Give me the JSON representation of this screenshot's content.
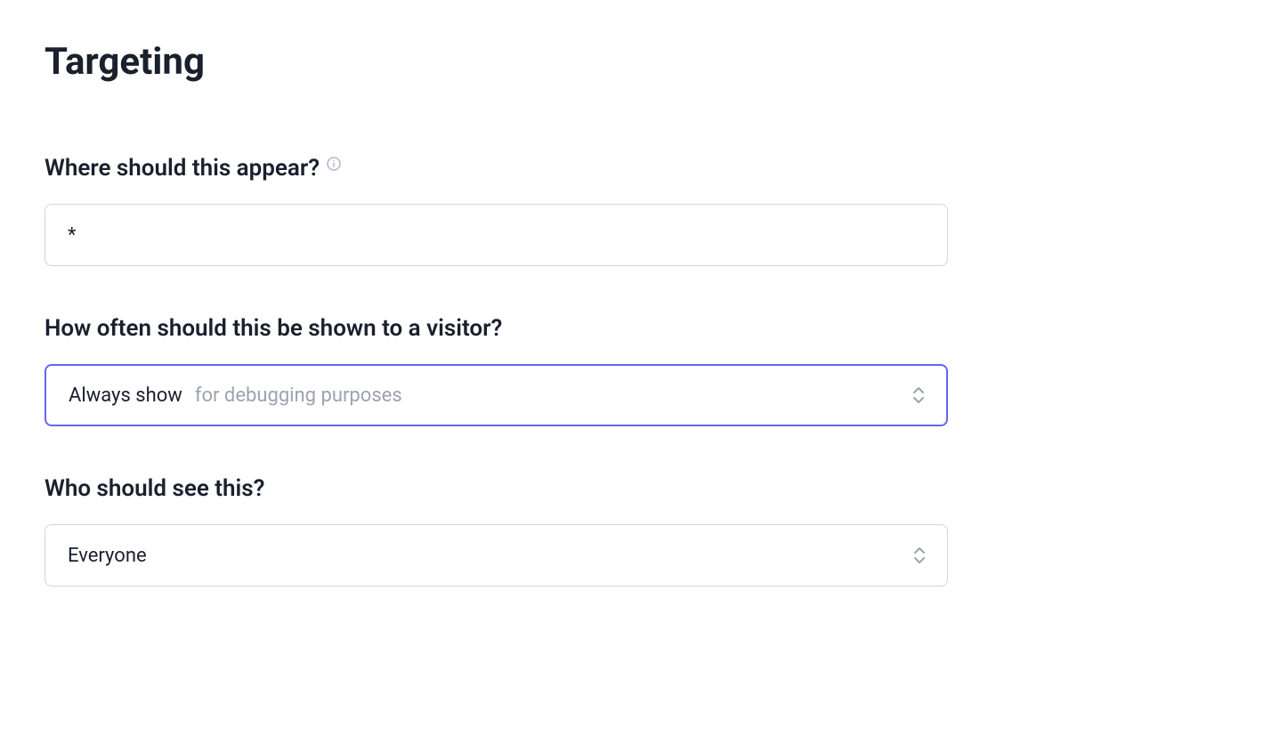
{
  "header": {
    "title": "Targeting"
  },
  "fields": {
    "where": {
      "label": "Where should this appear?",
      "value": "*"
    },
    "frequency": {
      "label": "How often should this be shown to a visitor?",
      "selected": "Always show",
      "hint": "for debugging purposes"
    },
    "audience": {
      "label": "Who should see this?",
      "selected": "Everyone"
    }
  }
}
